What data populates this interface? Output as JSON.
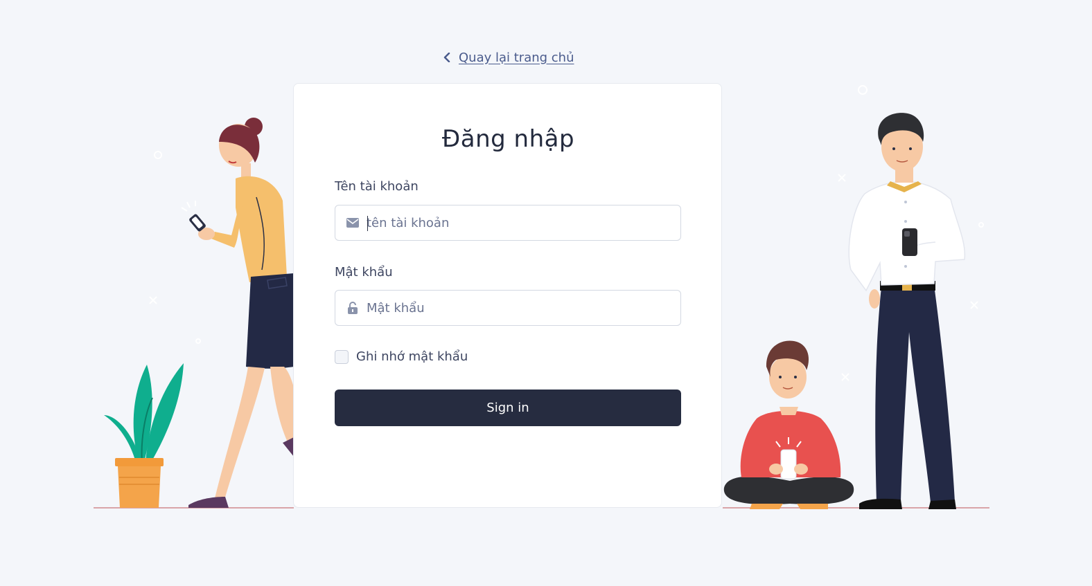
{
  "nav": {
    "back_label": "Quay lại trang chủ",
    "back_icon": "chevron-left-icon"
  },
  "login": {
    "title": "Đăng nhập",
    "username_label": "Tên tài khoản",
    "username_placeholder": "tên tài khoản",
    "username_icon": "envelope-icon",
    "password_label": "Mật khẩu",
    "password_placeholder": "Mật khẩu",
    "password_icon": "unlock-icon",
    "remember_label": "Ghi nhớ mật khẩu",
    "remember_checked": false,
    "submit_label": "Sign in"
  },
  "colors": {
    "background": "#f4f6fa",
    "card": "#ffffff",
    "button": "#262c40",
    "link": "#4a5b8c",
    "woman_top": "#f5bf6c",
    "boy_sweater": "#e8514f",
    "plant_pot": "#f4a44a",
    "plant_leaves": "#0fae8e",
    "trousers": "#232945"
  }
}
